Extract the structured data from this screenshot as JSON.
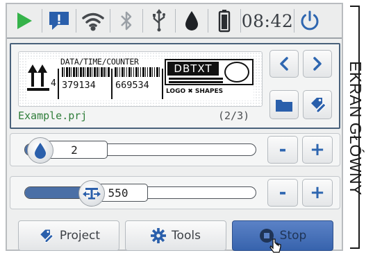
{
  "status_bar": {
    "icons": [
      "play-icon",
      "message-alert-icon",
      "wifi-icon",
      "bluetooth-icon",
      "usb-icon",
      "ink-drop-icon",
      "battery-icon",
      "power-icon"
    ],
    "time": "08:42"
  },
  "project": {
    "label": {
      "title": "DATA/TIME/COUNTER",
      "number_small": "4",
      "code1": "379134",
      "code2": "669534",
      "box_text": "DBTXT",
      "footer": "LOGO ✖ SHAPES"
    },
    "name": "Example.prj",
    "counter": "(2/3)"
  },
  "sliders": [
    {
      "icon": "ink-drop-icon",
      "value": "2",
      "level": 0.07
    },
    {
      "icon": "spread-arrows-icon",
      "value": "550",
      "level": 0.29
    }
  ],
  "stepper": {
    "minus": "-",
    "plus": "+"
  },
  "buttons": {
    "project": "Project",
    "tools": "Tools",
    "stop": "Stop"
  },
  "side_label": "EKRAN GŁÓWNY",
  "colors": {
    "accent": "#2e66b0",
    "play": "#35b34a",
    "project_name": "#2f7d3a",
    "stop_button": "#3f6db5"
  }
}
